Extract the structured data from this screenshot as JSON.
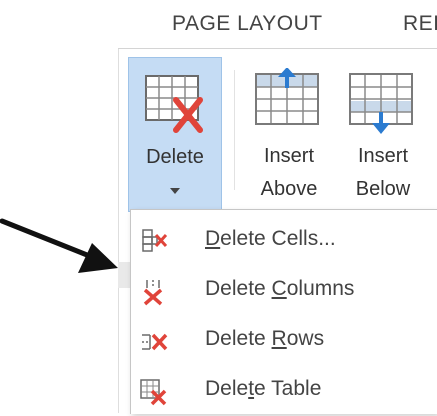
{
  "ribbon": {
    "tabs": [
      {
        "label": "PAGE LAYOUT"
      },
      {
        "label": "REI"
      }
    ],
    "buttons": {
      "delete": {
        "label": "Delete"
      },
      "insert_above": {
        "line1": "Insert",
        "line2": "Above"
      },
      "insert_below": {
        "line1": "Insert",
        "line2": "Below"
      }
    }
  },
  "menu": {
    "items": [
      {
        "pre": "",
        "accel": "D",
        "post": "elete Cells...",
        "icon": "delete-cells-icon"
      },
      {
        "pre": "Delete ",
        "accel": "C",
        "post": "olumns",
        "icon": "delete-columns-icon"
      },
      {
        "pre": "Delete ",
        "accel": "R",
        "post": "ows",
        "icon": "delete-rows-icon"
      },
      {
        "pre": "Dele",
        "accel": "t",
        "post": "e Table",
        "icon": "delete-table-icon"
      }
    ]
  },
  "colors": {
    "pressed_bg": "#c5dcf4",
    "delete_red": "#e0443a",
    "accent_blue": "#2b7bd0"
  }
}
